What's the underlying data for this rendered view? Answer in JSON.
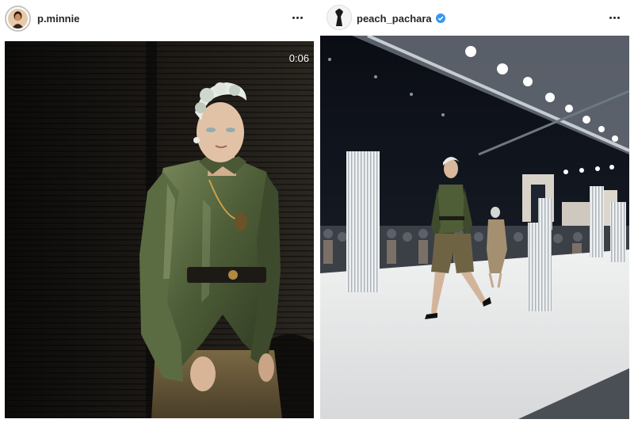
{
  "posts": [
    {
      "username": "p.minnie",
      "verified": false,
      "media_type": "video",
      "video_time": "0:06",
      "more_icon": "more-horizontal-icon"
    },
    {
      "username": "peach_pachara",
      "verified": true,
      "media_type": "photo",
      "more_icon": "more-horizontal-icon"
    }
  ],
  "colors": {
    "verified_badge": "#3897f0",
    "jacket_green": "#4e5e38",
    "runway_floor": "#e6e6e4"
  }
}
